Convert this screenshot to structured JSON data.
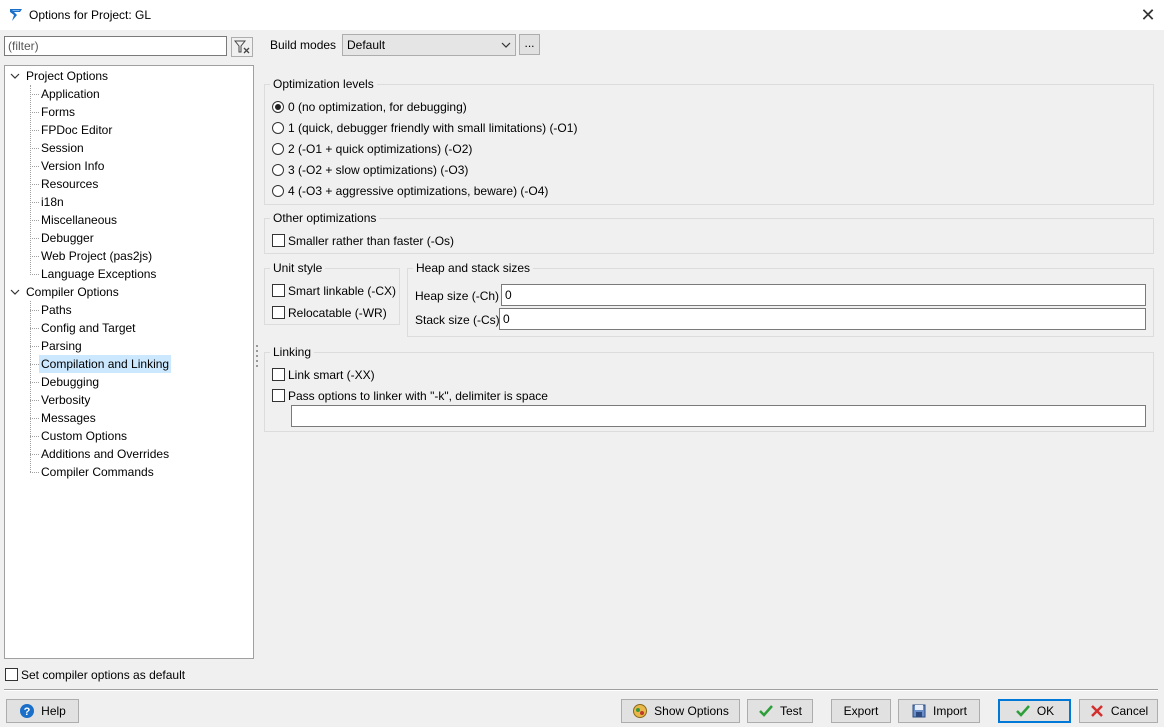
{
  "window": {
    "title": "Options for Project: GL",
    "close_glyph": "✕"
  },
  "filter": {
    "placeholder": "(filter)",
    "clear_icon": "filter-clear-icon"
  },
  "tree": {
    "groups": [
      {
        "label": "Project Options",
        "expanded": true,
        "items": [
          "Application",
          "Forms",
          "FPDoc Editor",
          "Session",
          "Version Info",
          "Resources",
          "i18n",
          "Miscellaneous",
          "Debugger",
          "Web Project (pas2js)",
          "Language Exceptions"
        ]
      },
      {
        "label": "Compiler Options",
        "expanded": true,
        "items": [
          "Paths",
          "Config and Target",
          "Parsing",
          "Compilation and Linking",
          "Debugging",
          "Verbosity",
          "Messages",
          "Custom Options",
          "Additions and Overrides",
          "Compiler Commands"
        ]
      }
    ],
    "selected": "Compilation and Linking",
    "selected_color": "#cce8ff"
  },
  "build_modes": {
    "label": "Build modes",
    "value": "Default",
    "dots_label": "..."
  },
  "optimization": {
    "title": "Optimization levels",
    "options": [
      "0 (no optimization, for debugging)",
      "1 (quick, debugger friendly with small limitations) (-O1)",
      "2 (-O1 + quick optimizations) (-O2)",
      "3 (-O2 + slow optimizations) (-O3)",
      "4 (-O3 + aggressive optimizations, beware) (-O4)"
    ],
    "selected_index": 0
  },
  "other_opt": {
    "title": "Other optimizations",
    "smaller_label": "Smaller rather than faster (-Os)",
    "smaller_checked": false
  },
  "unit_style": {
    "title": "Unit style",
    "smart_linkable": "Smart linkable (-CX)",
    "relocatable": "Relocatable (-WR)"
  },
  "heap_stack": {
    "title": "Heap and stack sizes",
    "heap_label": "Heap size (-Ch)",
    "heap_value": "0",
    "stack_label": "Stack size (-Cs)",
    "stack_value": "0"
  },
  "linking": {
    "title": "Linking",
    "link_smart": "Link smart (-XX)",
    "pass_options": "Pass options to linker with \"-k\", delimiter is space",
    "options_value": ""
  },
  "footer": {
    "set_default_label": "Set compiler options as default",
    "help": "Help",
    "show_options": "Show Options",
    "test": "Test",
    "export": "Export",
    "import": "Import",
    "ok": "OK",
    "cancel": "Cancel"
  },
  "colors": {
    "accent": "#0078d7",
    "ok_check": "#2e9e3a",
    "cancel_x": "#d32f2f",
    "help_icon": "#1a6fc9"
  }
}
